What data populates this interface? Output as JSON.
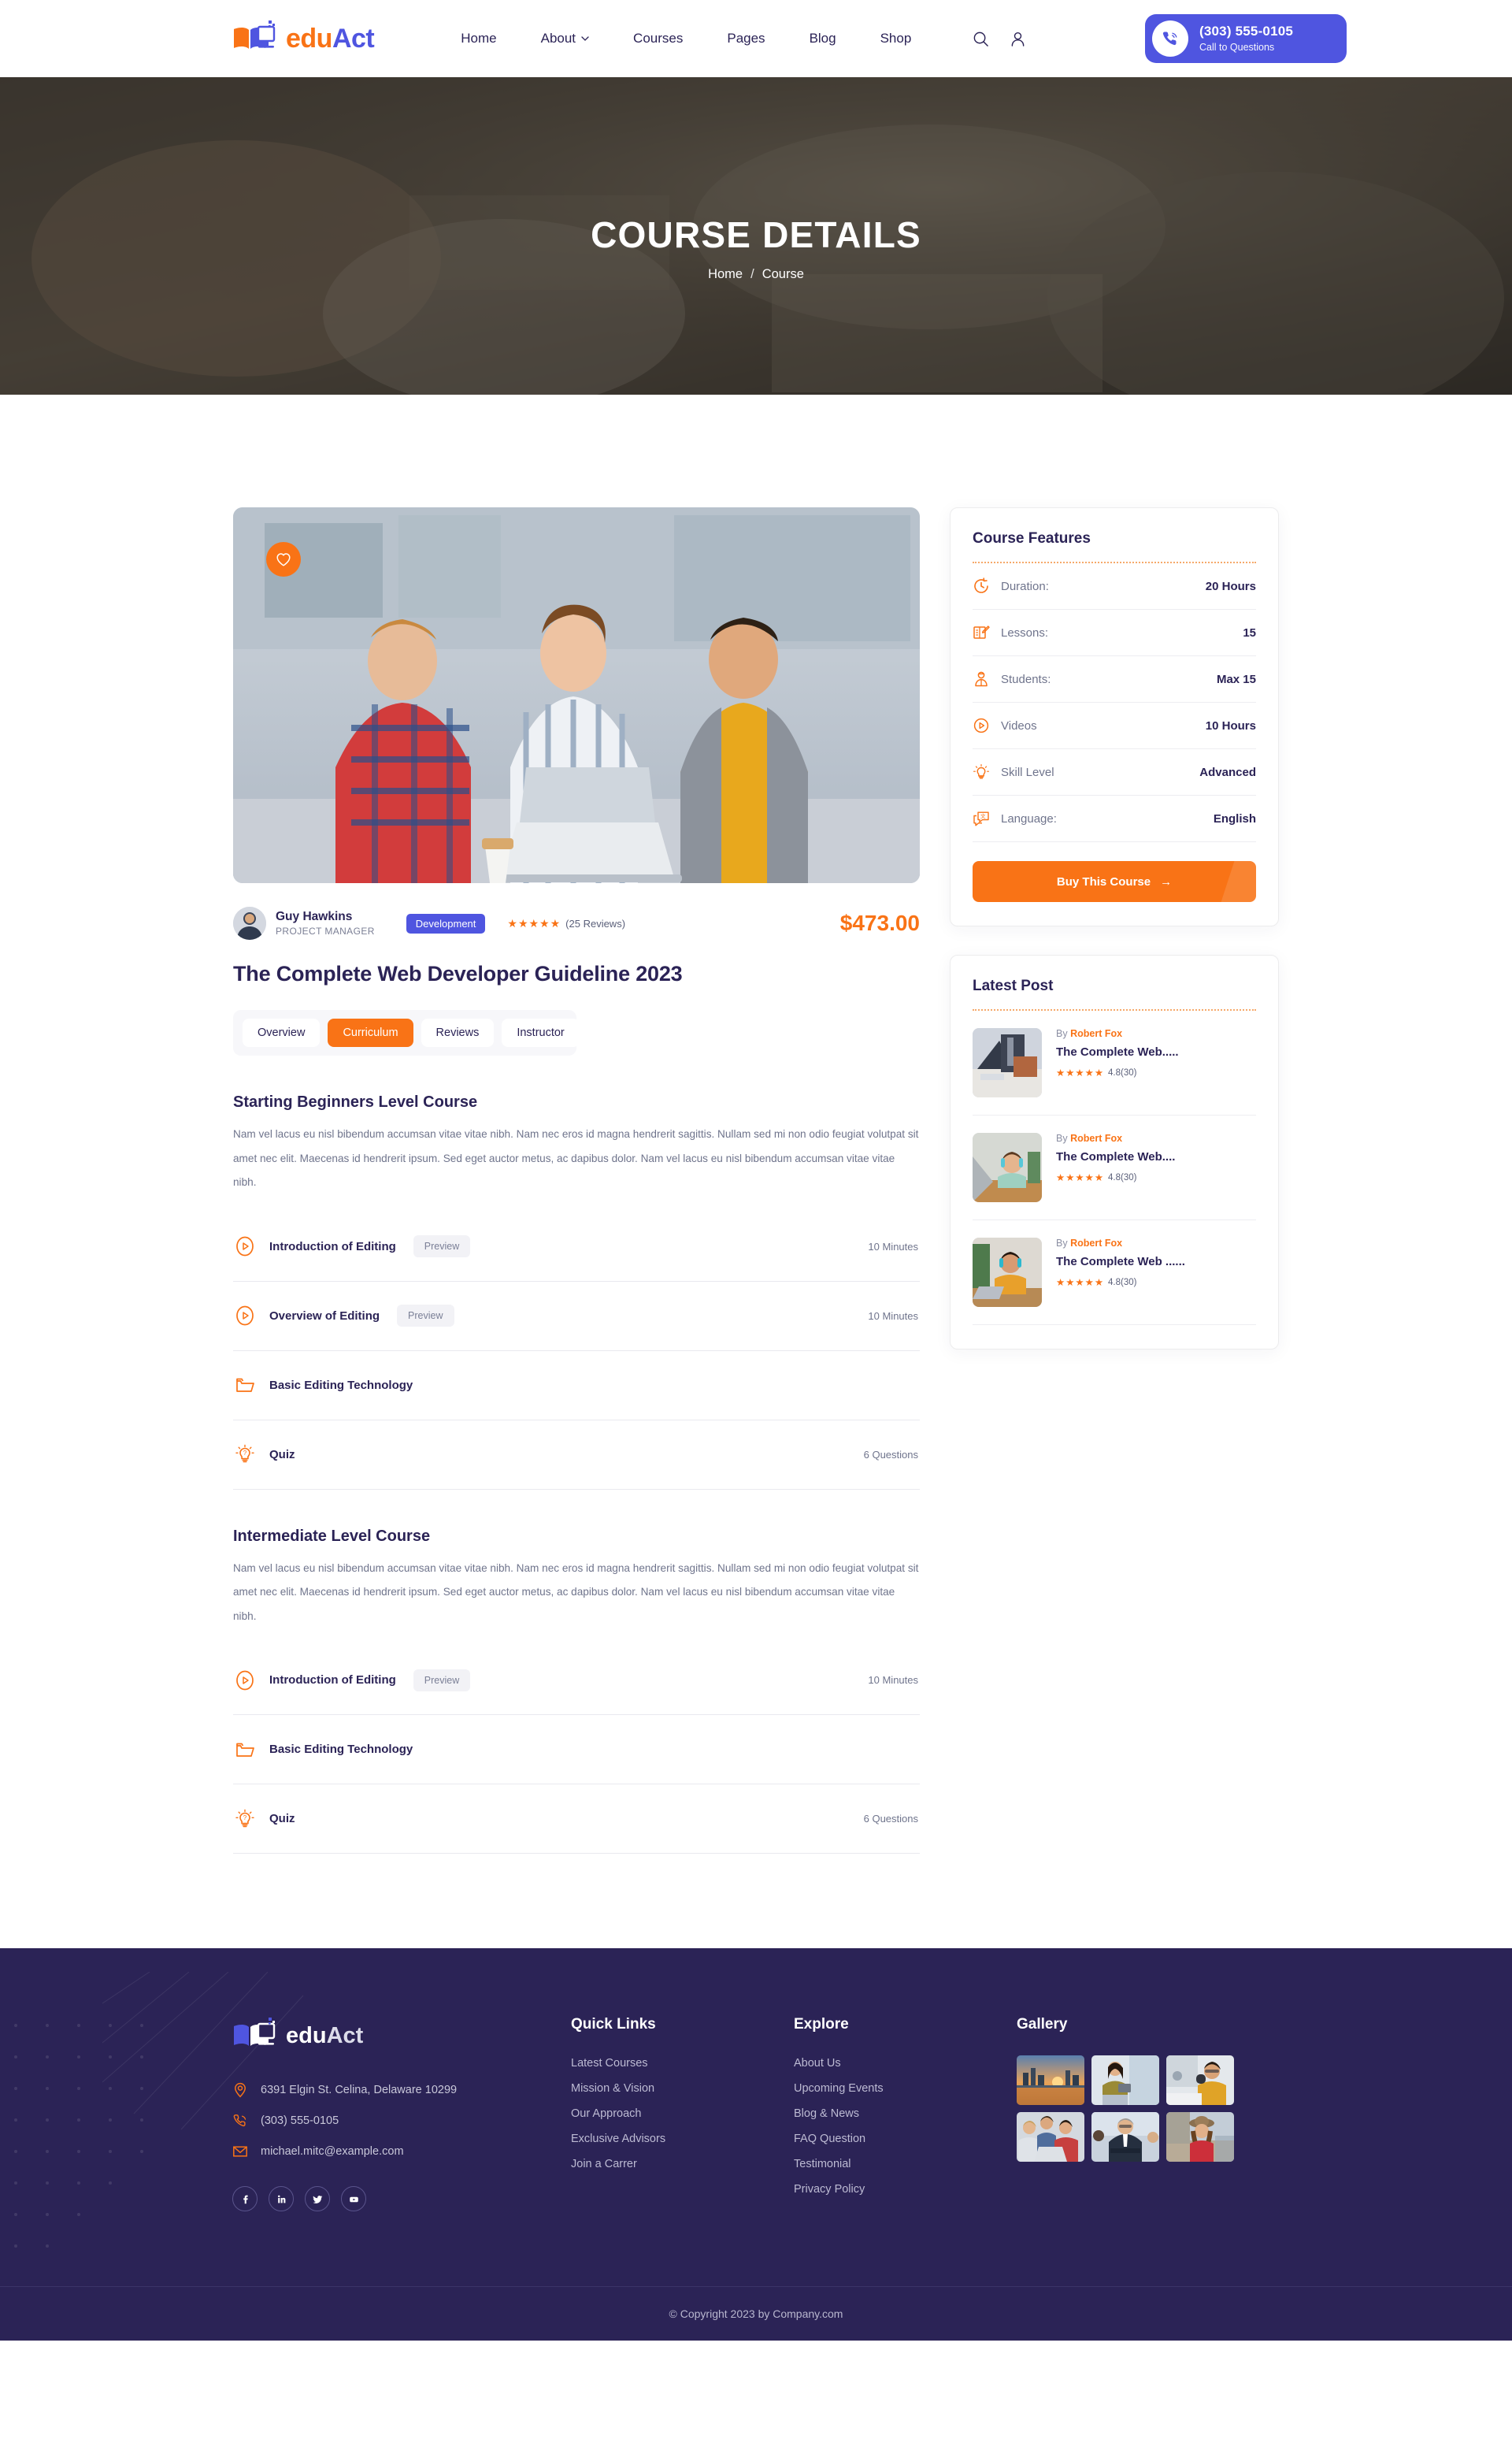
{
  "header": {
    "logo": {
      "edu": "edu",
      "act": "Act"
    },
    "nav": [
      {
        "label": "Home",
        "has_caret": false
      },
      {
        "label": "About",
        "has_caret": true
      },
      {
        "label": "Courses",
        "has_caret": false
      },
      {
        "label": "Pages",
        "has_caret": false
      },
      {
        "label": "Blog",
        "has_caret": false
      },
      {
        "label": "Shop",
        "has_caret": false
      }
    ],
    "search_icon": "search-icon",
    "account_icon": "user-icon",
    "call": {
      "phone": "(303) 555-0105",
      "caption": "Call to Questions",
      "icon": "phone-icon"
    }
  },
  "hero": {
    "title": "COURSE DETAILS",
    "breadcrumb": {
      "home": "Home",
      "separator": "/",
      "current": "Course"
    }
  },
  "course": {
    "favorite_icon": "heart-icon",
    "author": {
      "name": "Guy Hawkins",
      "role": "PROJECT MANAGER"
    },
    "category": "Development",
    "stars": "★★★★★",
    "reviews": "(25 Reviews)",
    "price": "$473.00",
    "title": "The Complete Web Developer Guideline 2023",
    "tabs": [
      {
        "label": "Overview",
        "active": false
      },
      {
        "label": "Curriculum",
        "active": true
      },
      {
        "label": "Reviews",
        "active": false
      },
      {
        "label": "Instructor",
        "active": false
      }
    ],
    "sections": [
      {
        "title": "Starting Beginners Level Course",
        "description": "Nam vel lacus eu nisl bibendum accumsan vitae vitae nibh. Nam nec eros id magna hendrerit sagittis. Nullam sed mi non odio feugiat volutpat sit amet nec elit. Maecenas id hendrerit ipsum. Sed eget auctor metus, ac dapibus dolor. Nam vel lacus eu nisl bibendum accumsan vitae vitae nibh.",
        "lessons": [
          {
            "icon": "play-circle-icon",
            "name": "Introduction of Editing",
            "chip": "Preview",
            "meta": "10 Minutes"
          },
          {
            "icon": "play-circle-icon",
            "name": "Overview of Editing",
            "chip": "Preview",
            "meta": "10 Minutes"
          },
          {
            "icon": "folder-icon",
            "name": "Basic Editing Technology",
            "chip": "",
            "meta": ""
          },
          {
            "icon": "bulb-icon",
            "name": "Quiz",
            "chip": "",
            "meta": "6 Questions"
          }
        ]
      },
      {
        "title": "Intermediate Level Course",
        "description": "Nam vel lacus eu nisl bibendum accumsan vitae vitae nibh. Nam nec eros id magna hendrerit sagittis. Nullam sed mi non odio feugiat volutpat sit amet nec elit. Maecenas id hendrerit ipsum. Sed eget auctor metus, ac dapibus dolor. Nam vel lacus eu nisl bibendum accumsan vitae vitae nibh.",
        "lessons": [
          {
            "icon": "play-circle-icon",
            "name": "Introduction of Editing",
            "chip": "Preview",
            "meta": "10 Minutes"
          },
          {
            "icon": "folder-icon",
            "name": "Basic Editing Technology",
            "chip": "",
            "meta": ""
          },
          {
            "icon": "bulb-icon",
            "name": "Quiz",
            "chip": "",
            "meta": "6 Questions"
          }
        ]
      }
    ]
  },
  "features": {
    "title": "Course Features",
    "rows": [
      {
        "icon": "clock-icon",
        "label": "Duration:",
        "value": "20 Hours"
      },
      {
        "icon": "book-pen-icon",
        "label": "Lessons:",
        "value": "15"
      },
      {
        "icon": "student-icon",
        "label": "Students:",
        "value": "Max 15"
      },
      {
        "icon": "play-circle-icon",
        "label": "Videos",
        "value": "10 Hours"
      },
      {
        "icon": "bulb-icon",
        "label": "Skill Level",
        "value": "Advanced"
      },
      {
        "icon": "translate-icon",
        "label": "Language:",
        "value": "English"
      }
    ],
    "buy_label": "Buy This Course",
    "buy_arrow": "→"
  },
  "latest_post": {
    "title": "Latest Post",
    "posts": [
      {
        "by_prefix": "By",
        "author": "Robert Fox",
        "title": "The Complete Web.....",
        "stars": "★★★★★",
        "rating": "4.8(30)"
      },
      {
        "by_prefix": "By",
        "author": "Robert Fox",
        "title": "The Complete Web....",
        "stars": "★★★★★",
        "rating": "4.8(30)"
      },
      {
        "by_prefix": "By",
        "author": "Robert Fox",
        "title": "The Complete Web ......",
        "stars": "★★★★★",
        "rating": "4.8(30)"
      }
    ]
  },
  "footer": {
    "logo": {
      "edu": "edu",
      "act": "Act"
    },
    "contacts": [
      {
        "icon": "location-icon",
        "text": "6391 Elgin St. Celina, Delaware 10299"
      },
      {
        "icon": "phone-icon",
        "text": "(303) 555-0105"
      },
      {
        "icon": "mail-icon",
        "text": "michael.mitc@example.com"
      }
    ],
    "social": [
      {
        "icon": "facebook-icon",
        "glyph": "f"
      },
      {
        "icon": "linkedin-icon",
        "glyph": "in"
      },
      {
        "icon": "twitter-icon",
        "glyph": "t"
      },
      {
        "icon": "youtube-icon",
        "glyph": "yt"
      }
    ],
    "quick_links": {
      "title": "Quick Links",
      "items": [
        "Latest Courses",
        "Mission & Vision",
        "Our Approach",
        "Exclusive Advisors",
        "Join a Carrer"
      ]
    },
    "explore": {
      "title": "Explore",
      "items": [
        "About Us",
        "Upcoming Events",
        "Blog & News",
        "FAQ Question",
        "Testimonial",
        "Privacy Policy"
      ]
    },
    "gallery": {
      "title": "Gallery",
      "count": 6
    },
    "copyright": "© Copyright 2023 by Company.com"
  },
  "colors": {
    "accent_orange": "#f97316",
    "accent_blue": "#4f55e0",
    "dark_navy": "#2b2356",
    "muted_text": "#6f748c"
  }
}
